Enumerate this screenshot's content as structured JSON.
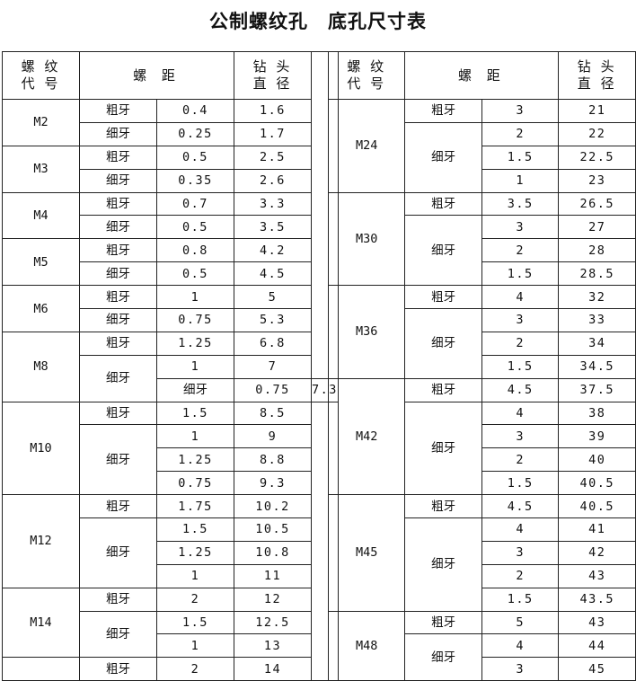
{
  "title": "公制螺纹孔　底孔尺寸表",
  "headers": {
    "code": "螺 纹\n代 号",
    "pitch": "螺 距",
    "drill": "钻 头\n直 径"
  },
  "left_table": [
    {
      "code": "M2",
      "rows": [
        {
          "type": "粗牙",
          "pitch": "0.4",
          "drill": "1.6"
        },
        {
          "type": "细牙",
          "pitch": "0.25",
          "drill": "1.7"
        }
      ]
    },
    {
      "code": "M3",
      "rows": [
        {
          "type": "粗牙",
          "pitch": "0.5",
          "drill": "2.5"
        },
        {
          "type": "细牙",
          "pitch": "0.35",
          "drill": "2.6"
        }
      ]
    },
    {
      "code": "M4",
      "rows": [
        {
          "type": "粗牙",
          "pitch": "0.7",
          "drill": "3.3"
        },
        {
          "type": "细牙",
          "pitch": "0.5",
          "drill": "3.5"
        }
      ]
    },
    {
      "code": "M5",
      "rows": [
        {
          "type": "粗牙",
          "pitch": "0.8",
          "drill": "4.2"
        },
        {
          "type": "细牙",
          "pitch": "0.5",
          "drill": "4.5"
        }
      ]
    },
    {
      "code": "M6",
      "rows": [
        {
          "type": "粗牙",
          "pitch": "1",
          "drill": "5"
        },
        {
          "type": "细牙",
          "pitch": "0.75",
          "drill": "5.3"
        }
      ]
    },
    {
      "code": "M8",
      "rows": [
        {
          "type": "粗牙",
          "pitch": "1.25",
          "drill": "6.8"
        },
        {
          "type": "细牙",
          "pitch": "1",
          "drill": "7"
        },
        {
          "type": "细牙",
          "pitch": "0.75",
          "drill": "7.3"
        }
      ]
    },
    {
      "code": "M10",
      "rows": [
        {
          "type": "粗牙",
          "pitch": "1.5",
          "drill": "8.5"
        },
        {
          "type": "细牙",
          "pitch": "1",
          "drill": "9"
        },
        {
          "type": "",
          "pitch": "1.25",
          "drill": "8.8"
        },
        {
          "type": "",
          "pitch": "0.75",
          "drill": "9.3"
        }
      ]
    },
    {
      "code": "M12",
      "rows": [
        {
          "type": "粗牙",
          "pitch": "1.75",
          "drill": "10.2"
        },
        {
          "type": "细牙",
          "pitch": "1.5",
          "drill": "10.5"
        },
        {
          "type": "",
          "pitch": "1.25",
          "drill": "10.8"
        },
        {
          "type": "",
          "pitch": "1",
          "drill": "11"
        }
      ]
    },
    {
      "code": "M14",
      "rows": [
        {
          "type": "粗牙",
          "pitch": "2",
          "drill": "12"
        },
        {
          "type": "细牙",
          "pitch": "1.5",
          "drill": "12.5"
        },
        {
          "type": "",
          "pitch": "1",
          "drill": "13"
        }
      ]
    },
    {
      "code": "",
      "rows": [
        {
          "type": "粗牙",
          "pitch": "2",
          "drill": "14"
        }
      ]
    }
  ],
  "right_table": [
    {
      "code": "M24",
      "rows": [
        {
          "type": "粗牙",
          "pitch": "3",
          "drill": "21"
        },
        {
          "type": "细牙",
          "pitch": "2",
          "drill": "22"
        },
        {
          "type": "",
          "pitch": "1.5",
          "drill": "22.5"
        },
        {
          "type": "",
          "pitch": "1",
          "drill": "23"
        }
      ]
    },
    {
      "code": "M30",
      "rows": [
        {
          "type": "粗牙",
          "pitch": "3.5",
          "drill": "26.5"
        },
        {
          "type": "细牙",
          "pitch": "3",
          "drill": "27"
        },
        {
          "type": "",
          "pitch": "2",
          "drill": "28"
        },
        {
          "type": "",
          "pitch": "1.5",
          "drill": "28.5"
        }
      ]
    },
    {
      "code": "M36",
      "rows": [
        {
          "type": "粗牙",
          "pitch": "4",
          "drill": "32"
        },
        {
          "type": "细牙",
          "pitch": "3",
          "drill": "33"
        },
        {
          "type": "",
          "pitch": "2",
          "drill": "34"
        },
        {
          "type": "",
          "pitch": "1.5",
          "drill": "34.5"
        }
      ]
    },
    {
      "code": "M42",
      "rows": [
        {
          "type": "粗牙",
          "pitch": "4.5",
          "drill": "37.5"
        },
        {
          "type": "细牙",
          "pitch": "4",
          "drill": "38"
        },
        {
          "type": "",
          "pitch": "3",
          "drill": "39"
        },
        {
          "type": "",
          "pitch": "2",
          "drill": "40"
        },
        {
          "type": "",
          "pitch": "1.5",
          "drill": "40.5"
        }
      ]
    },
    {
      "code": "M45",
      "rows": [
        {
          "type": "粗牙",
          "pitch": "4.5",
          "drill": "40.5"
        },
        {
          "type": "细牙",
          "pitch": "4",
          "drill": "41"
        },
        {
          "type": "",
          "pitch": "3",
          "drill": "42"
        },
        {
          "type": "",
          "pitch": "2",
          "drill": "43"
        },
        {
          "type": "",
          "pitch": "1.5",
          "drill": "43.5"
        }
      ]
    },
    {
      "code": "M48",
      "rows": [
        {
          "type": "粗牙",
          "pitch": "5",
          "drill": "43"
        },
        {
          "type": "细牙",
          "pitch": "4",
          "drill": "44"
        },
        {
          "type": "",
          "pitch": "3",
          "drill": "45"
        }
      ]
    }
  ]
}
